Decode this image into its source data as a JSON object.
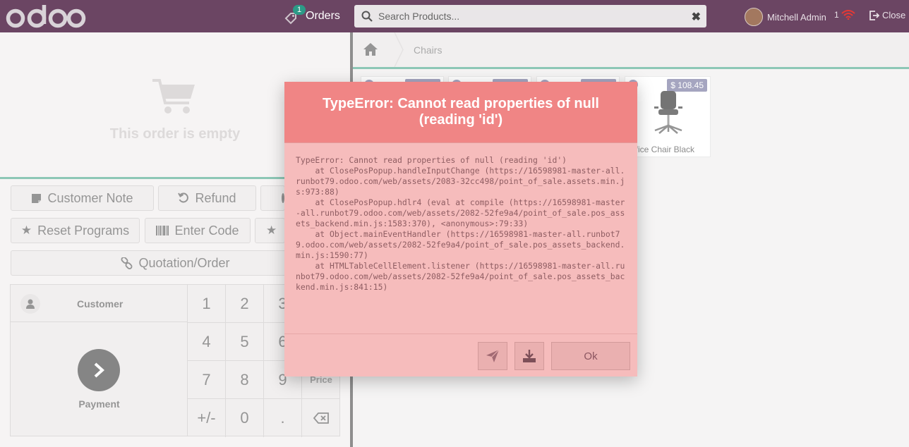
{
  "header": {
    "logo_text": "odoo",
    "orders_label": "Orders",
    "orders_count": "1",
    "search_placeholder": "Search Products...",
    "user_name": "Mitchell Admin",
    "sync_count": "1",
    "close_label": "Close"
  },
  "order": {
    "empty_message": "This order is empty"
  },
  "controls": {
    "customer_note": "Customer Note",
    "refund": "Refund",
    "reset_programs": "Reset Programs",
    "enter_code": "Enter Code",
    "quotation_order": "Quotation/Order"
  },
  "numpad": {
    "customer_label": "Customer",
    "payment_label": "Payment",
    "keys": [
      "1",
      "2",
      "3",
      "4",
      "5",
      "6",
      "7",
      "8",
      "9",
      "+/-",
      "0",
      "."
    ],
    "price_label": "Price"
  },
  "breadcrumb": {
    "category": "Chairs"
  },
  "products": [
    {
      "name": "Office Chair Black",
      "price": "$ 108.45"
    }
  ],
  "popup": {
    "title": "TypeError: Cannot read properties of null (reading 'id')",
    "body": "TypeError: Cannot read properties of null (reading 'id')\n    at ClosePosPopup.handleInputChange (https://16598981-master-all.runbot79.odoo.com/web/assets/2083-32cc498/point_of_sale.assets.min.js:973:88)\n    at ClosePosPopup.hdlr4 (eval at compile (https://16598981-master-all.runbot79.odoo.com/web/assets/2082-52fe9a4/point_of_sale.pos_assets_backend.min.js:1583:370), <anonymous>:79:33)\n    at Object.mainEventHandler (https://16598981-master-all.runbot79.odoo.com/web/assets/2082-52fe9a4/point_of_sale.pos_assets_backend.min.js:1590:77)\n    at HTMLTableCellElement.listener (https://16598981-master-all.runbot79.odoo.com/web/assets/2082-52fe9a4/point_of_sale.pos_assets_backend.min.js:841:15)",
    "ok_label": "Ok"
  },
  "colors": {
    "header_bg": "#6b4563",
    "accent_green": "#47a58a",
    "badge": "#2c9a87",
    "error_header": "#f08585",
    "error_body": "#f6bcbc",
    "price_tag": "#6e6f99"
  },
  "icons": [
    "orders-icon",
    "search-icon",
    "clear-search-icon",
    "wifi-icon",
    "sign-out-icon",
    "cart-icon",
    "note-icon",
    "undo-icon",
    "star-icon",
    "barcode-icon",
    "link-icon",
    "user-icon",
    "chevron-right-icon",
    "backspace-icon",
    "home-icon",
    "send-icon",
    "download-icon"
  ]
}
